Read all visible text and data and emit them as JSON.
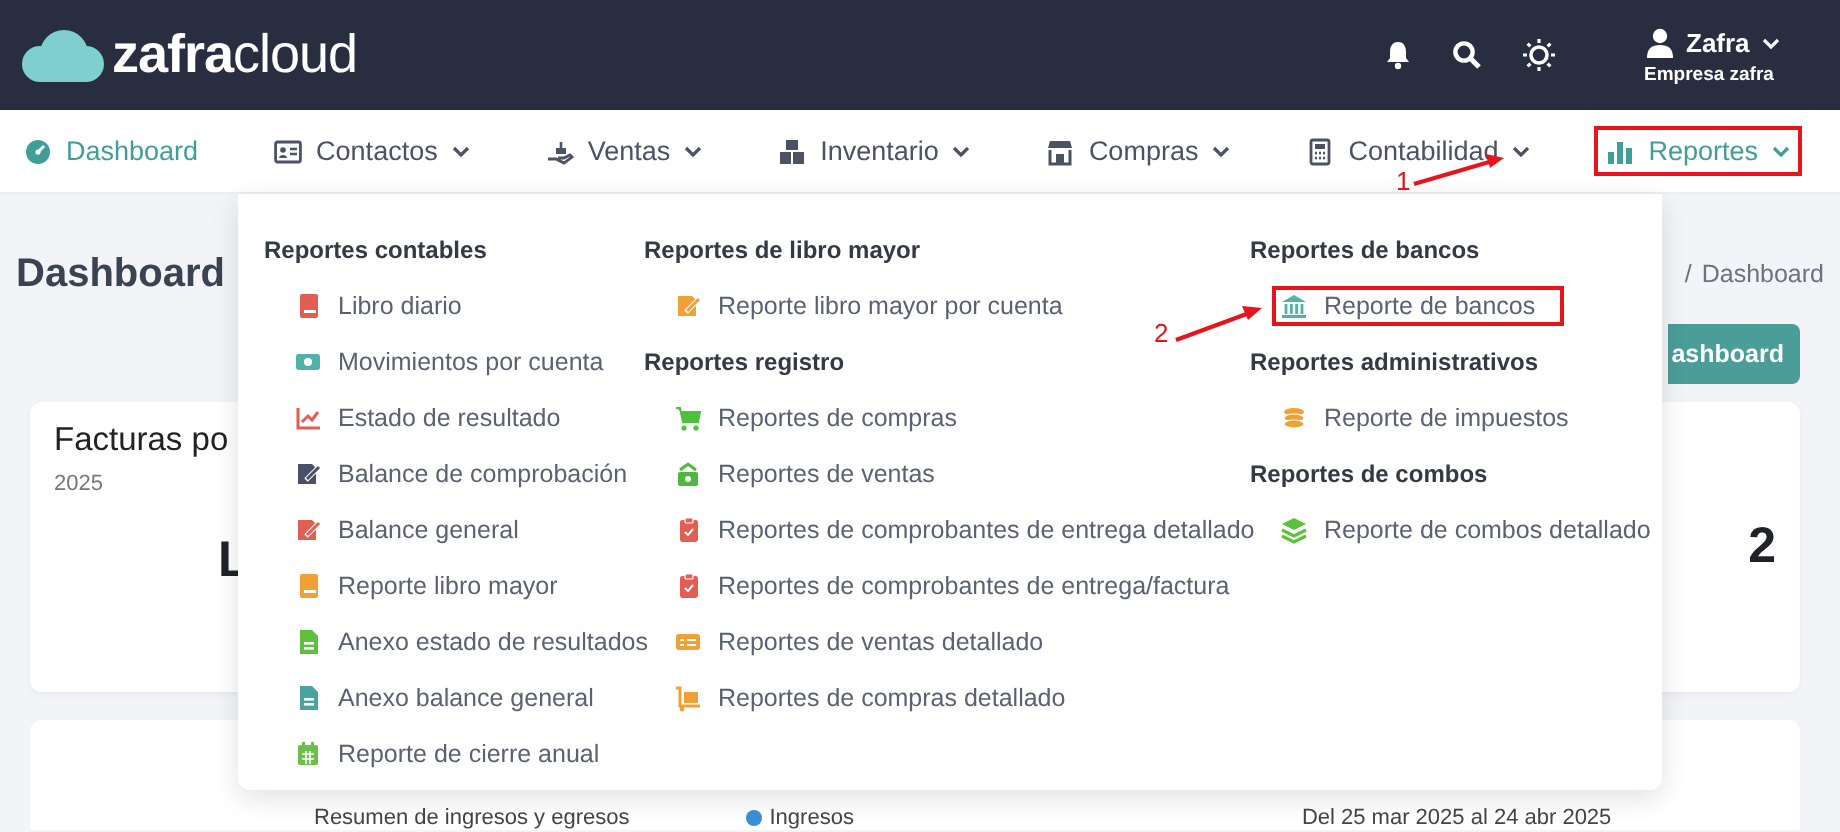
{
  "header": {
    "logo": {
      "name": "zafra",
      "suffix": "cloud"
    },
    "user": {
      "name": "Zafra",
      "company": "Empresa zafra"
    }
  },
  "nav": {
    "items": [
      {
        "label": "Dashboard",
        "selected": true,
        "dropdown": false,
        "highlighted": false
      },
      {
        "label": "Contactos",
        "selected": false,
        "dropdown": true,
        "highlighted": false
      },
      {
        "label": "Ventas",
        "selected": false,
        "dropdown": true,
        "highlighted": false
      },
      {
        "label": "Inventario",
        "selected": false,
        "dropdown": true,
        "highlighted": false
      },
      {
        "label": "Compras",
        "selected": false,
        "dropdown": true,
        "highlighted": false
      },
      {
        "label": "Contabilidad",
        "selected": false,
        "dropdown": true,
        "highlighted": false
      },
      {
        "label": "Reportes",
        "selected": true,
        "dropdown": true,
        "highlighted": true
      }
    ]
  },
  "page": {
    "title": "Dashboard",
    "breadcrumb": {
      "separator": "/",
      "current": "Dashboard"
    },
    "button": "ashboard",
    "cards": [
      {
        "title": "Facturas po",
        "subtitle": "2025",
        "value": "L"
      },
      {
        "value": "2"
      }
    ],
    "summary": {
      "title": "Resumen de ingresos y egresos",
      "legend": {
        "label": "Ingresos",
        "color": "#3b8fd9"
      },
      "range": "Del 25 mar 2025 al 24 abr 2025"
    }
  },
  "menu": {
    "columns": [
      {
        "sections": [
          {
            "heading": "Reportes contables",
            "items": [
              {
                "label": "Libro diario",
                "highlighted": false
              },
              {
                "label": "Movimientos por cuenta",
                "highlighted": false
              },
              {
                "label": "Estado de resultado",
                "highlighted": false
              },
              {
                "label": "Balance de comprobación",
                "highlighted": false
              },
              {
                "label": "Balance general",
                "highlighted": false
              },
              {
                "label": "Reporte libro mayor",
                "highlighted": false
              },
              {
                "label": "Anexo estado de resultados",
                "highlighted": false
              },
              {
                "label": "Anexo balance general",
                "highlighted": false
              },
              {
                "label": "Reporte de cierre anual",
                "highlighted": false
              }
            ]
          }
        ]
      },
      {
        "sections": [
          {
            "heading": "Reportes de libro mayor",
            "items": [
              {
                "label": "Reporte libro mayor por cuenta",
                "highlighted": false
              }
            ]
          },
          {
            "heading": "Reportes registro",
            "items": [
              {
                "label": "Reportes de compras",
                "highlighted": false
              },
              {
                "label": "Reportes de ventas",
                "highlighted": false
              },
              {
                "label": "Reportes de comprobantes de entrega detallado",
                "highlighted": false
              },
              {
                "label": "Reportes de comprobantes de entrega/factura",
                "highlighted": false
              },
              {
                "label": "Reportes de ventas detallado",
                "highlighted": false
              },
              {
                "label": "Reportes de compras detallado",
                "highlighted": false
              }
            ]
          }
        ]
      },
      {
        "sections": [
          {
            "heading": "Reportes de bancos",
            "items": [
              {
                "label": "Reporte de bancos",
                "highlighted": true
              }
            ]
          },
          {
            "heading": "Reportes administrativos",
            "items": [
              {
                "label": "Reporte de impuestos",
                "highlighted": false
              }
            ]
          },
          {
            "heading": "Reportes de combos",
            "items": [
              {
                "label": "Reporte de combos detallado",
                "highlighted": false
              }
            ]
          }
        ]
      }
    ]
  },
  "annotations": [
    {
      "label": "1"
    },
    {
      "label": "2"
    }
  ]
}
